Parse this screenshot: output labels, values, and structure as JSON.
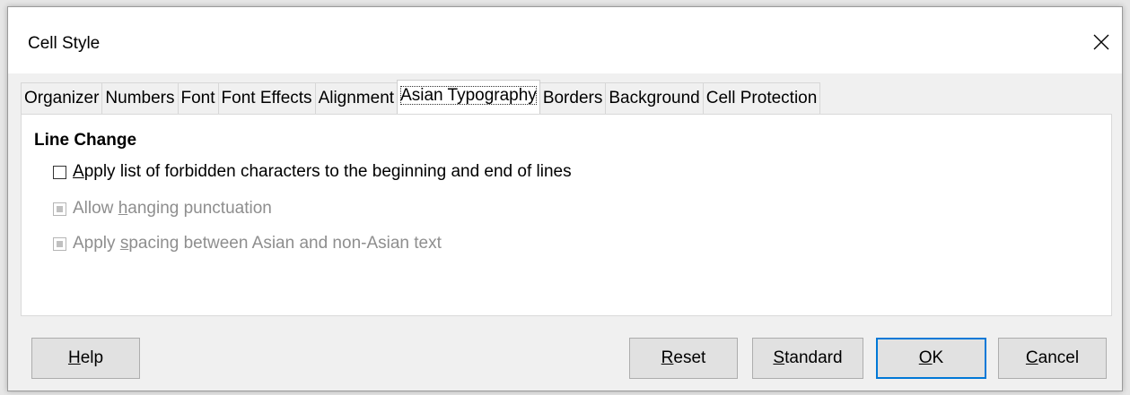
{
  "window": {
    "title": "Cell Style"
  },
  "tabs": [
    {
      "label": "Organizer",
      "active": false
    },
    {
      "label": "Numbers",
      "active": false
    },
    {
      "label": "Font",
      "active": false
    },
    {
      "label": "Font Effects",
      "active": false
    },
    {
      "label": "Alignment",
      "active": false
    },
    {
      "label": "Asian Typography",
      "active": true
    },
    {
      "label": "Borders",
      "active": false
    },
    {
      "label": "Background",
      "active": false
    },
    {
      "label": "Cell Protection",
      "active": false
    }
  ],
  "section": {
    "title": "Line Change",
    "options": [
      {
        "pre": "",
        "mnemonic": "A",
        "post": "pply list of forbidden characters to the beginning and end of lines",
        "checked": false,
        "enabled": true
      },
      {
        "pre": "Allow ",
        "mnemonic": "h",
        "post": "anging punctuation",
        "checked": "indeterminate",
        "enabled": false
      },
      {
        "pre": "Apply ",
        "mnemonic": "s",
        "post": "pacing between Asian and non-Asian text",
        "checked": "indeterminate",
        "enabled": false
      }
    ]
  },
  "buttons": {
    "help": {
      "pre": "",
      "mnemonic": "H",
      "post": "elp"
    },
    "reset": {
      "pre": "",
      "mnemonic": "R",
      "post": "eset"
    },
    "standard": {
      "pre": "",
      "mnemonic": "S",
      "post": "tandard"
    },
    "ok": {
      "pre": "",
      "mnemonic": "O",
      "post": "K"
    },
    "cancel": {
      "pre": "",
      "mnemonic": "C",
      "post": "ancel"
    }
  },
  "icons": {
    "close": "close-icon"
  }
}
